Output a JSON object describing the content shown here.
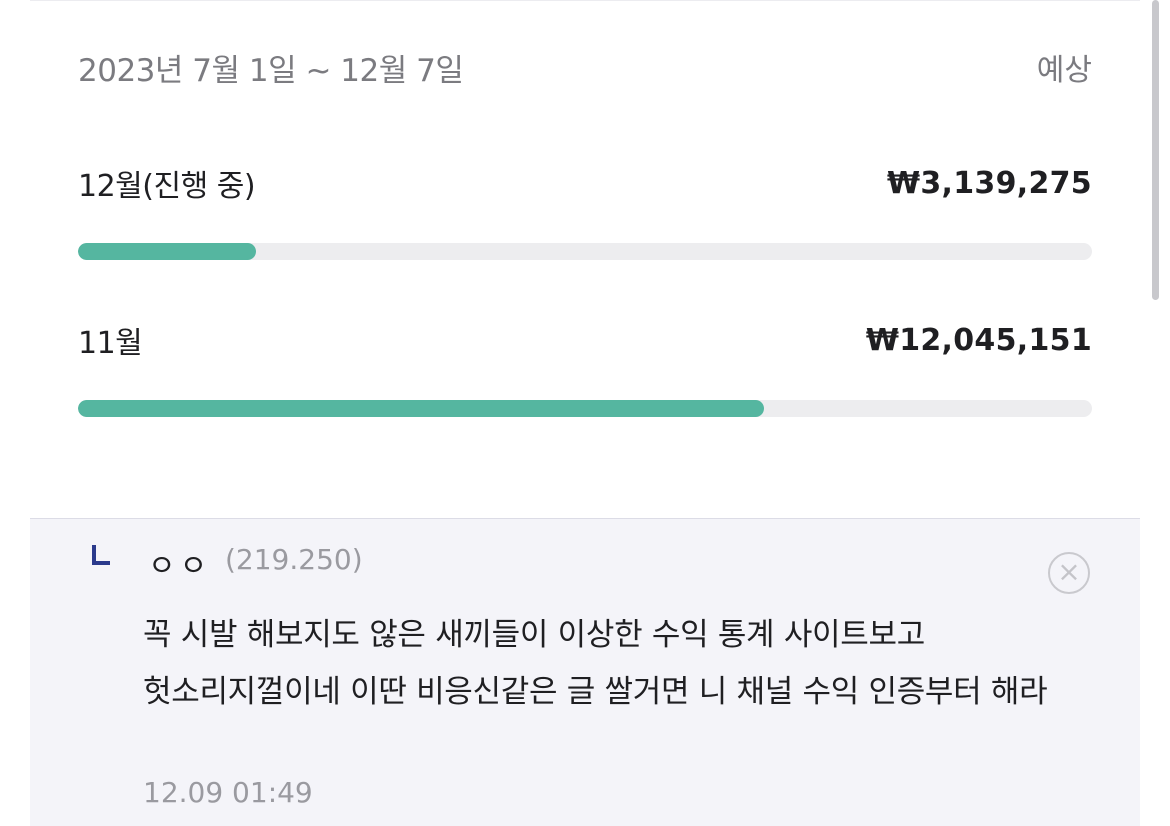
{
  "stats": {
    "period": "2023년 7월 1일 ~ 12월 7일",
    "forecast_label": "예상",
    "months": [
      {
        "label": "12월(진행 중)",
        "amount": "₩3,139,275",
        "progress": 0.176
      },
      {
        "label": "11월",
        "amount": "₩12,045,151",
        "progress": 0.677
      }
    ],
    "accent_color": "#55b6a0"
  },
  "reply": {
    "author": "ㅇㅇ",
    "ip": "(219.250)",
    "text": "꼭 시발 해보지도 않은 새끼들이 이상한 수익 통계 사이트보고 헛소리지껄이네 이딴 비응신같은 글 쌀거면 니 채널 수익 인증부터 해라",
    "timestamp": "12.09 01:49",
    "close_icon": "×",
    "marker_color": "#2b3a8c"
  }
}
